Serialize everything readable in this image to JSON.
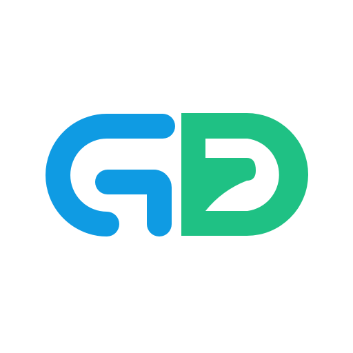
{
  "logo": {
    "letters": [
      "G",
      "D"
    ],
    "colors": {
      "background": "#ffffff",
      "left_letter": "#0f9be3",
      "right_letter": "#1fc184"
    }
  }
}
